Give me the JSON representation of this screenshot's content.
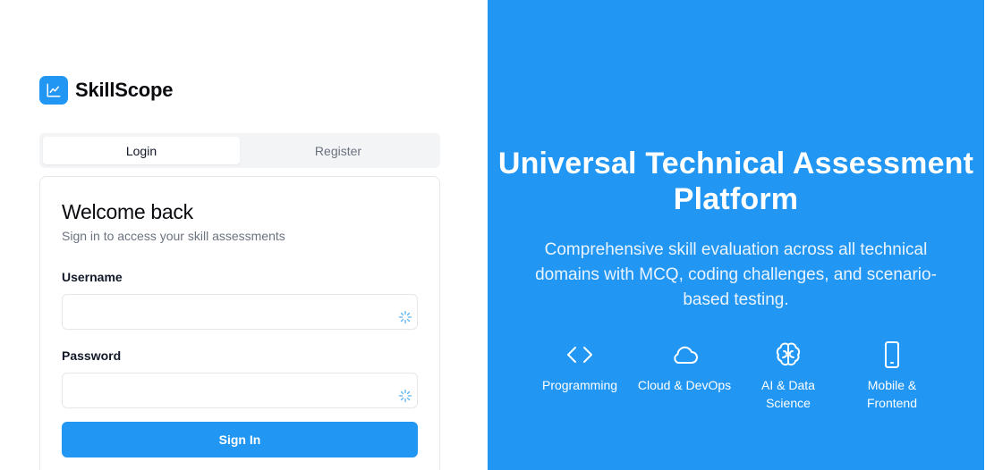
{
  "brand": {
    "name": "SkillScope",
    "logo_icon": "chart-line-icon",
    "color": "#2196f3"
  },
  "tabs": [
    {
      "label": "Login",
      "active": true
    },
    {
      "label": "Register",
      "active": false
    }
  ],
  "card": {
    "title": "Welcome back",
    "subtitle": "Sign in to access your skill assessments",
    "username": {
      "label": "Username",
      "value": "",
      "placeholder": "",
      "icon": "password-manager-icon"
    },
    "password": {
      "label": "Password",
      "value": "",
      "placeholder": "",
      "icon": "password-manager-icon"
    },
    "submit_label": "Sign In"
  },
  "hero": {
    "title": "Universal Technical Assessment Platform",
    "description": "Comprehensive skill evaluation across all technical domains with MCQ, coding challenges, and scenario-based testing.",
    "background": "#2196f3",
    "features": [
      {
        "icon": "code-icon",
        "label": "Programming"
      },
      {
        "icon": "cloud-icon",
        "label": "Cloud & DevOps"
      },
      {
        "icon": "brain-icon",
        "label": "AI & Data Science"
      },
      {
        "icon": "smartphone-icon",
        "label": "Mobile & Frontend"
      }
    ]
  }
}
